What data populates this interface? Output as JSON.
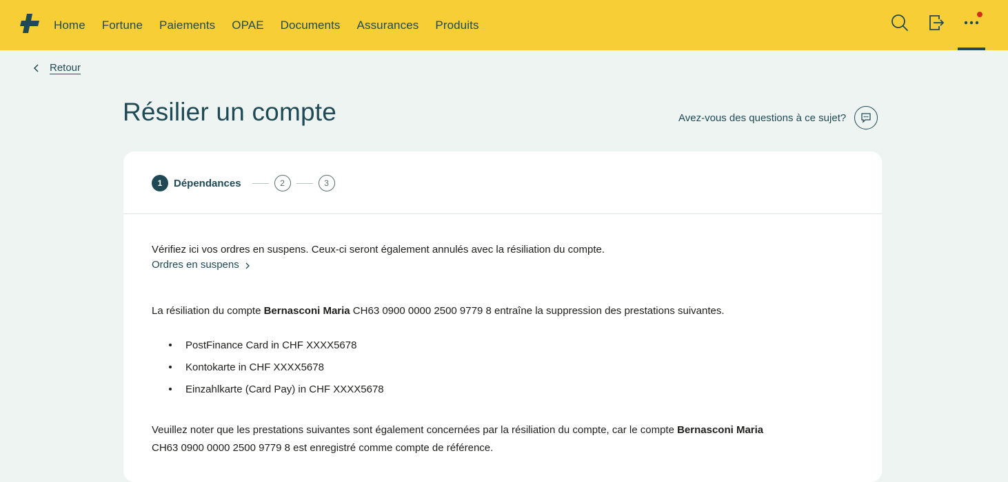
{
  "nav": {
    "items": [
      {
        "label": "Home"
      },
      {
        "label": "Fortune"
      },
      {
        "label": "Paiements"
      },
      {
        "label": "OPAE"
      },
      {
        "label": "Documents"
      },
      {
        "label": "Assurances"
      },
      {
        "label": "Produits"
      }
    ],
    "icons": [
      "search-icon",
      "logout-icon",
      "more-icon"
    ],
    "brand_color": "#f7ce35",
    "accent_color": "#1f4a55",
    "notification_color": "#d42e1b"
  },
  "back": {
    "label": "Retour"
  },
  "page": {
    "title": "Résilier un compte"
  },
  "help": {
    "label": "Avez-vous des questions à ce sujet?",
    "icon": "chat-icon"
  },
  "stepper": {
    "active_number": "1",
    "active_label": "Dépendances",
    "step2": "2",
    "step3": "3"
  },
  "content": {
    "intro": "Vérifiez ici vos ordres en suspens. Ceux-ci seront également annulés avec la résiliation du compte.",
    "orders_link": "Ordres en suspens",
    "para1_prefix": "La résiliation du compte ",
    "account_holder": "Bernasconi Maria",
    "para1_iban": " CH63 0900 0000 2500 9779 8",
    "para1_suffix": " entraîne la suppression des prestations suivantes.",
    "services": [
      {
        "label": "PostFinance Card in CHF XXXX5678"
      },
      {
        "label": "Kontokarte in CHF XXXX5678"
      },
      {
        "label": "Einzahlkarte (Card Pay) in CHF XXXX5678"
      }
    ],
    "para2_prefix": "Veuillez noter que les prestations suivantes sont également concernées par la résiliation du compte, car le compte ",
    "para2_holder": "Bernasconi Maria",
    "para2_line2": "CH63 0900 0000 2500 9779 8 est enregistré comme compte de référence."
  }
}
